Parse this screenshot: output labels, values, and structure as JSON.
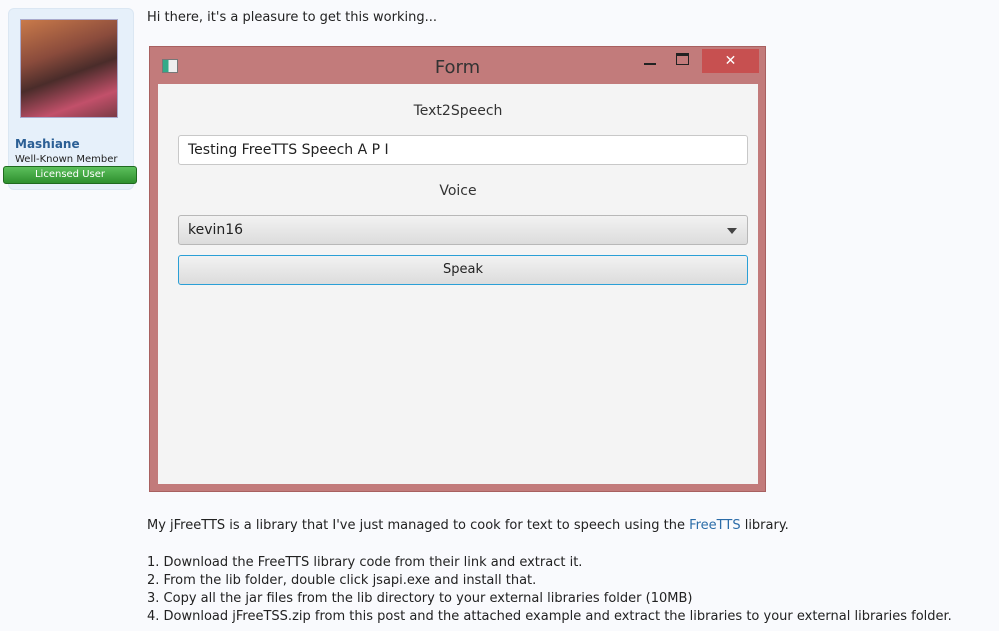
{
  "user": {
    "name": "Mashiane",
    "title": "Well-Known Member",
    "badge": "Licensed User"
  },
  "post": {
    "greeting": "Hi there, it's a pleasure to get this working...",
    "intro_before": "My jFreeTTS is a library that I've just managed to cook for text to speech using the ",
    "intro_link": "FreeTTS",
    "intro_after": " library.",
    "steps": [
      "1. Download the FreeTTS library code from their link and extract it.",
      "2. From the lib folder, double click jsapi.exe and install that.",
      "3. Copy all the jar files from the lib directory to your external libraries folder (10MB)",
      "4. Download jFreeTSS.zip from this post and the attached example and extract the libraries to your external libraries folder."
    ]
  },
  "window": {
    "title": "Form",
    "close": "✕"
  },
  "form": {
    "heading": "Text2Speech",
    "text_value": "Testing FreeTTS Speech A P I",
    "voice_label": "Voice",
    "voice_selected": "kevin16",
    "speak_label": "Speak"
  },
  "colors": {
    "window_border": "#c27b7b",
    "close_button": "#c75050",
    "link": "#2b6ca8",
    "badge": "#3a9f3a"
  }
}
